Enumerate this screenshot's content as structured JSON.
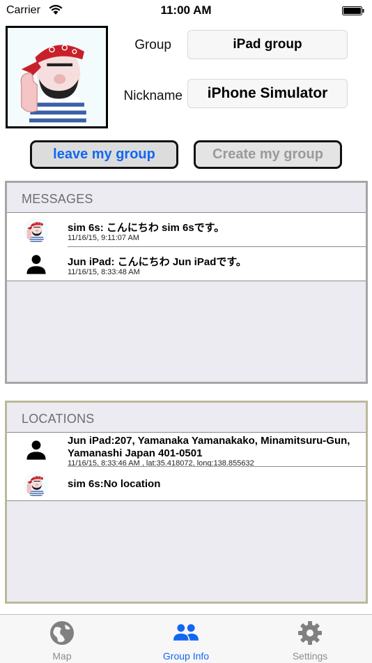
{
  "status_bar": {
    "carrier": "Carrier",
    "time": "11:00 AM",
    "wifi_icon": "wifi-icon",
    "battery_icon": "battery-icon"
  },
  "profile": {
    "avatar_icon": "cartoon-avatar",
    "group_label": "Group",
    "group_value": "iPad group",
    "nickname_label": "Nickname",
    "nickname_value": "iPhone Simulator"
  },
  "actions": {
    "leave_label": "leave my group",
    "create_label": "Create my group"
  },
  "colors": {
    "accent": "#1267f0",
    "disabled": "#9a9a9a",
    "panel_bg": "#ebebf1",
    "messages_border": "#a6a6a6",
    "locations_border": "#bcb89b"
  },
  "messages": {
    "header": "MESSAGES",
    "items": [
      {
        "icon": "cartoon-avatar",
        "title": "sim 6s: こんにちわ sim 6sです。",
        "timestamp": "11/16/15, 9:11:07 AM"
      },
      {
        "icon": "person-icon",
        "title": "Jun iPad: こんにちわ Jun iPadです。",
        "timestamp": "11/16/15, 8:33:48 AM"
      }
    ]
  },
  "locations": {
    "header": "LOCATIONS",
    "items": [
      {
        "icon": "person-icon",
        "title": "Jun iPad:207, Yamanaka Yamanakako, Minamitsuru-Gun, Yamanashi Japan 401-0501",
        "detail": "11/16/15, 8:33:46 AM  , lat:35.418072, long:138.855632"
      },
      {
        "icon": "cartoon-avatar",
        "title": "sim 6s:No location"
      }
    ]
  },
  "tab_bar": {
    "tabs": [
      {
        "label": "Map",
        "icon": "globe-icon",
        "selected": false
      },
      {
        "label": "Group Info",
        "icon": "group-icon",
        "selected": true
      },
      {
        "label": "Settings",
        "icon": "gear-icon",
        "selected": false
      }
    ]
  }
}
